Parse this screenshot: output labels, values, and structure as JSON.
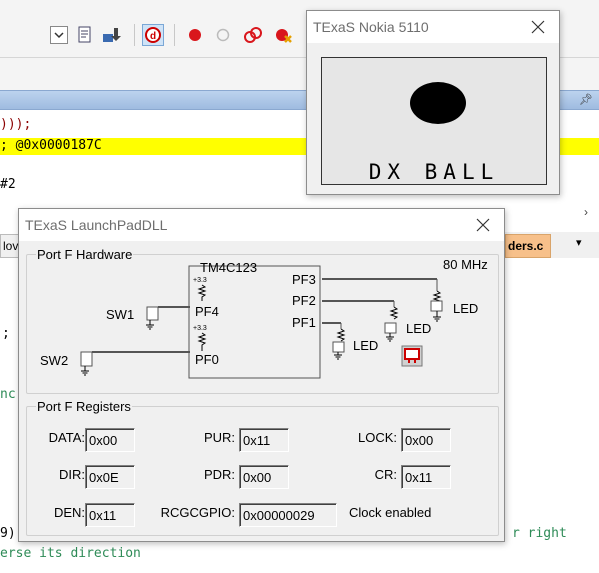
{
  "ide": {
    "code_lines": [
      {
        "text": "))); ",
        "color": "#8b0000"
      },
      {
        "text": "; @0x0000187C",
        "color": "#000"
      },
      {
        "text": "#2",
        "color": "#000"
      }
    ],
    "left_fragments": [
      {
        "text": ";",
        "color": "#000"
      },
      {
        "text": "nc",
        "color": "#2e8b57"
      },
      {
        "text": "9)",
        "color": "#000"
      }
    ],
    "tab_left_label": "lov",
    "tab_right_label": "ders.c",
    "bottom_line1": "r right",
    "bottom_line2": "erse its direction"
  },
  "nokia": {
    "title": "TExaS Nokia 5110",
    "screen_text": "DX BALL"
  },
  "launchpad": {
    "title": "TExaS LaunchPadDLL",
    "hardware": {
      "group_label": "Port F Hardware",
      "chip": "TM4C123",
      "freq": "80 MHz",
      "pins": {
        "pf3": "PF3",
        "pf2": "PF2",
        "pf1": "PF1",
        "pf4": "PF4",
        "pf0": "PF0"
      },
      "switches": {
        "sw1": "SW1",
        "sw2": "SW2"
      },
      "led": "LED",
      "pullup": "+3.3"
    },
    "registers": {
      "group_label": "Port F Registers",
      "data": {
        "label": "DATA:",
        "value": "0x00"
      },
      "dir": {
        "label": "DIR:",
        "value": "0x0E"
      },
      "den": {
        "label": "DEN:",
        "value": "0x11"
      },
      "pur": {
        "label": "PUR:",
        "value": "0x11"
      },
      "pdr": {
        "label": "PDR:",
        "value": "0x00"
      },
      "rcgc": {
        "label": "RCGCGPIO:",
        "value": "0x00000029"
      },
      "lock": {
        "label": "LOCK:",
        "value": "0x00"
      },
      "cr": {
        "label": "CR:",
        "value": "0x11"
      },
      "clock_status": "Clock enabled"
    }
  },
  "colors": {
    "highlight": "#ffff00",
    "comment_green": "#2e8b57",
    "led_red": "#cc0000"
  }
}
